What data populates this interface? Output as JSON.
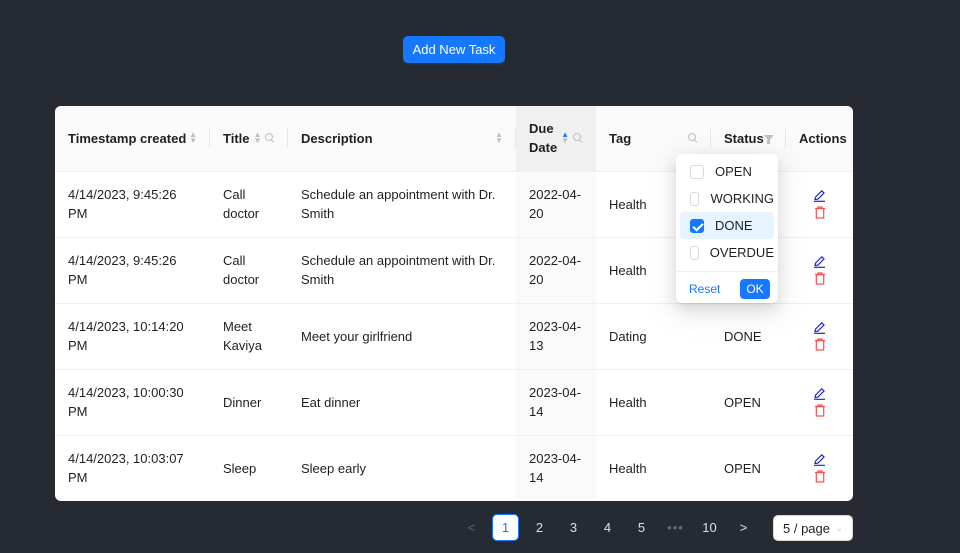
{
  "toolbar": {
    "add_label": "Add New Task"
  },
  "table": {
    "headers": {
      "timestamp": "Timestamp created",
      "title": "Title",
      "description": "Description",
      "due_date": "Due Date",
      "tag": "Tag",
      "status": "Status",
      "actions": "Actions"
    },
    "rows": [
      {
        "timestamp": "4/14/2023, 9:45:26 PM",
        "title": "Call doctor",
        "description": "Schedule an appointment with Dr. Smith",
        "due_date": "2022-04-20",
        "tag": "Health",
        "status": ""
      },
      {
        "timestamp": "4/14/2023, 9:45:26 PM",
        "title": "Call doctor",
        "description": "Schedule an appointment with Dr. Smith",
        "due_date": "2022-04-20",
        "tag": "Health",
        "status": ""
      },
      {
        "timestamp": "4/14/2023, 10:14:20 PM",
        "title": "Meet Kaviya",
        "description": "Meet your girlfriend",
        "due_date": "2023-04-13",
        "tag": "Dating",
        "status": "DONE"
      },
      {
        "timestamp": "4/14/2023, 10:00:30 PM",
        "title": "Dinner",
        "description": "Eat dinner",
        "due_date": "2023-04-14",
        "tag": "Health",
        "status": "OPEN"
      },
      {
        "timestamp": "4/14/2023, 10:03:07 PM",
        "title": "Sleep",
        "description": "Sleep early",
        "due_date": "2023-04-14",
        "tag": "Health",
        "status": "OPEN"
      }
    ]
  },
  "status_filter": {
    "options": [
      {
        "label": "OPEN",
        "checked": false
      },
      {
        "label": "WORKING",
        "checked": false
      },
      {
        "label": "DONE",
        "checked": true
      },
      {
        "label": "OVERDUE",
        "checked": false
      }
    ],
    "reset_label": "Reset",
    "ok_label": "OK"
  },
  "pagination": {
    "prev": "<",
    "pages": [
      "1",
      "2",
      "3",
      "4",
      "5"
    ],
    "ellipsis": "•••",
    "last": "10",
    "next": ">",
    "current": "1",
    "page_size": "5 / page"
  },
  "colors": {
    "primary": "#1677ff",
    "danger": "#ff4d4f",
    "background": "#262a33"
  }
}
